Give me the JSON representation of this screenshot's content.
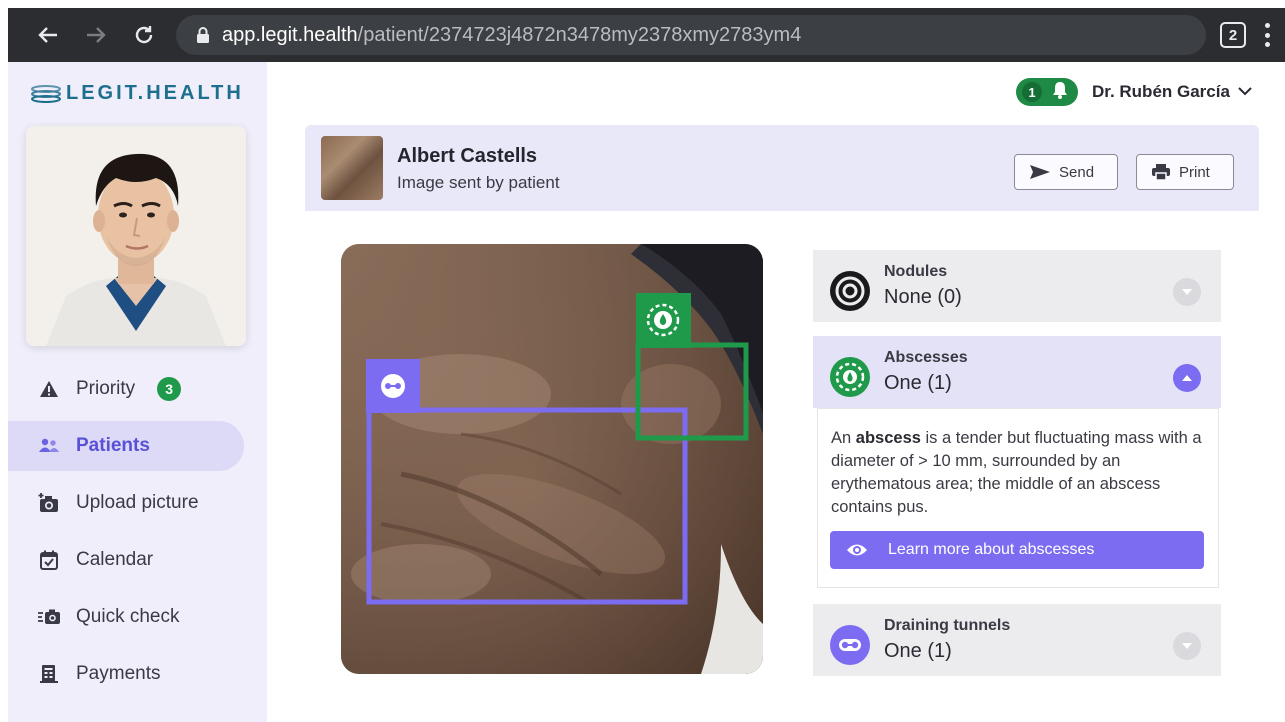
{
  "browser": {
    "url_host": "app.legit.health",
    "url_path": "/patient/2374723j4872n3478my2378xmy2783ym4",
    "tab_count": "2",
    "back_icon": "arrow-left-icon",
    "forward_icon": "arrow-right-icon",
    "reload_icon": "reload-icon"
  },
  "sidebar": {
    "logo_text": "LEGIT.HEALTH",
    "items": [
      {
        "label": "Priority",
        "icon": "warning-triangle-icon",
        "badge": "3"
      },
      {
        "label": "Patients",
        "icon": "users-icon",
        "active": true
      },
      {
        "label": "Upload picture",
        "icon": "add-photo-icon"
      },
      {
        "label": "Calendar",
        "icon": "calendar-check-icon"
      },
      {
        "label": "Quick check",
        "icon": "quick-camera-icon"
      },
      {
        "label": "Payments",
        "icon": "receipt-icon"
      }
    ]
  },
  "user": {
    "notification_count": "1",
    "doctor_name": "Dr. Rubén García"
  },
  "patient": {
    "name": "Albert Castells",
    "subtitle": "Image sent by patient",
    "send_label": "Send",
    "print_label": "Print"
  },
  "findings": [
    {
      "title": "Nodules",
      "value": "None (0)",
      "icon": "nodule-icon",
      "expanded": false
    },
    {
      "title": "Abscesses",
      "value": "One (1)",
      "icon": "abscess-icon",
      "expanded": true,
      "description_pre": "An ",
      "description_term": "abscess",
      "description_post": " is a tender but fluctuating mass with a diameter of > 10 mm, surrounded by an erythematous area; the middle of an abscess contains pus.",
      "learn_more": "Learn more about abscesses"
    },
    {
      "title": "Draining tunnels",
      "value": "One (1)",
      "icon": "draining-tunnel-icon",
      "expanded": false
    }
  ],
  "colors": {
    "accent": "#7b6cf2",
    "abscess_green": "#1f9a4a",
    "sidebar_bg": "#efeefa",
    "logo": "#1e6f8e"
  }
}
